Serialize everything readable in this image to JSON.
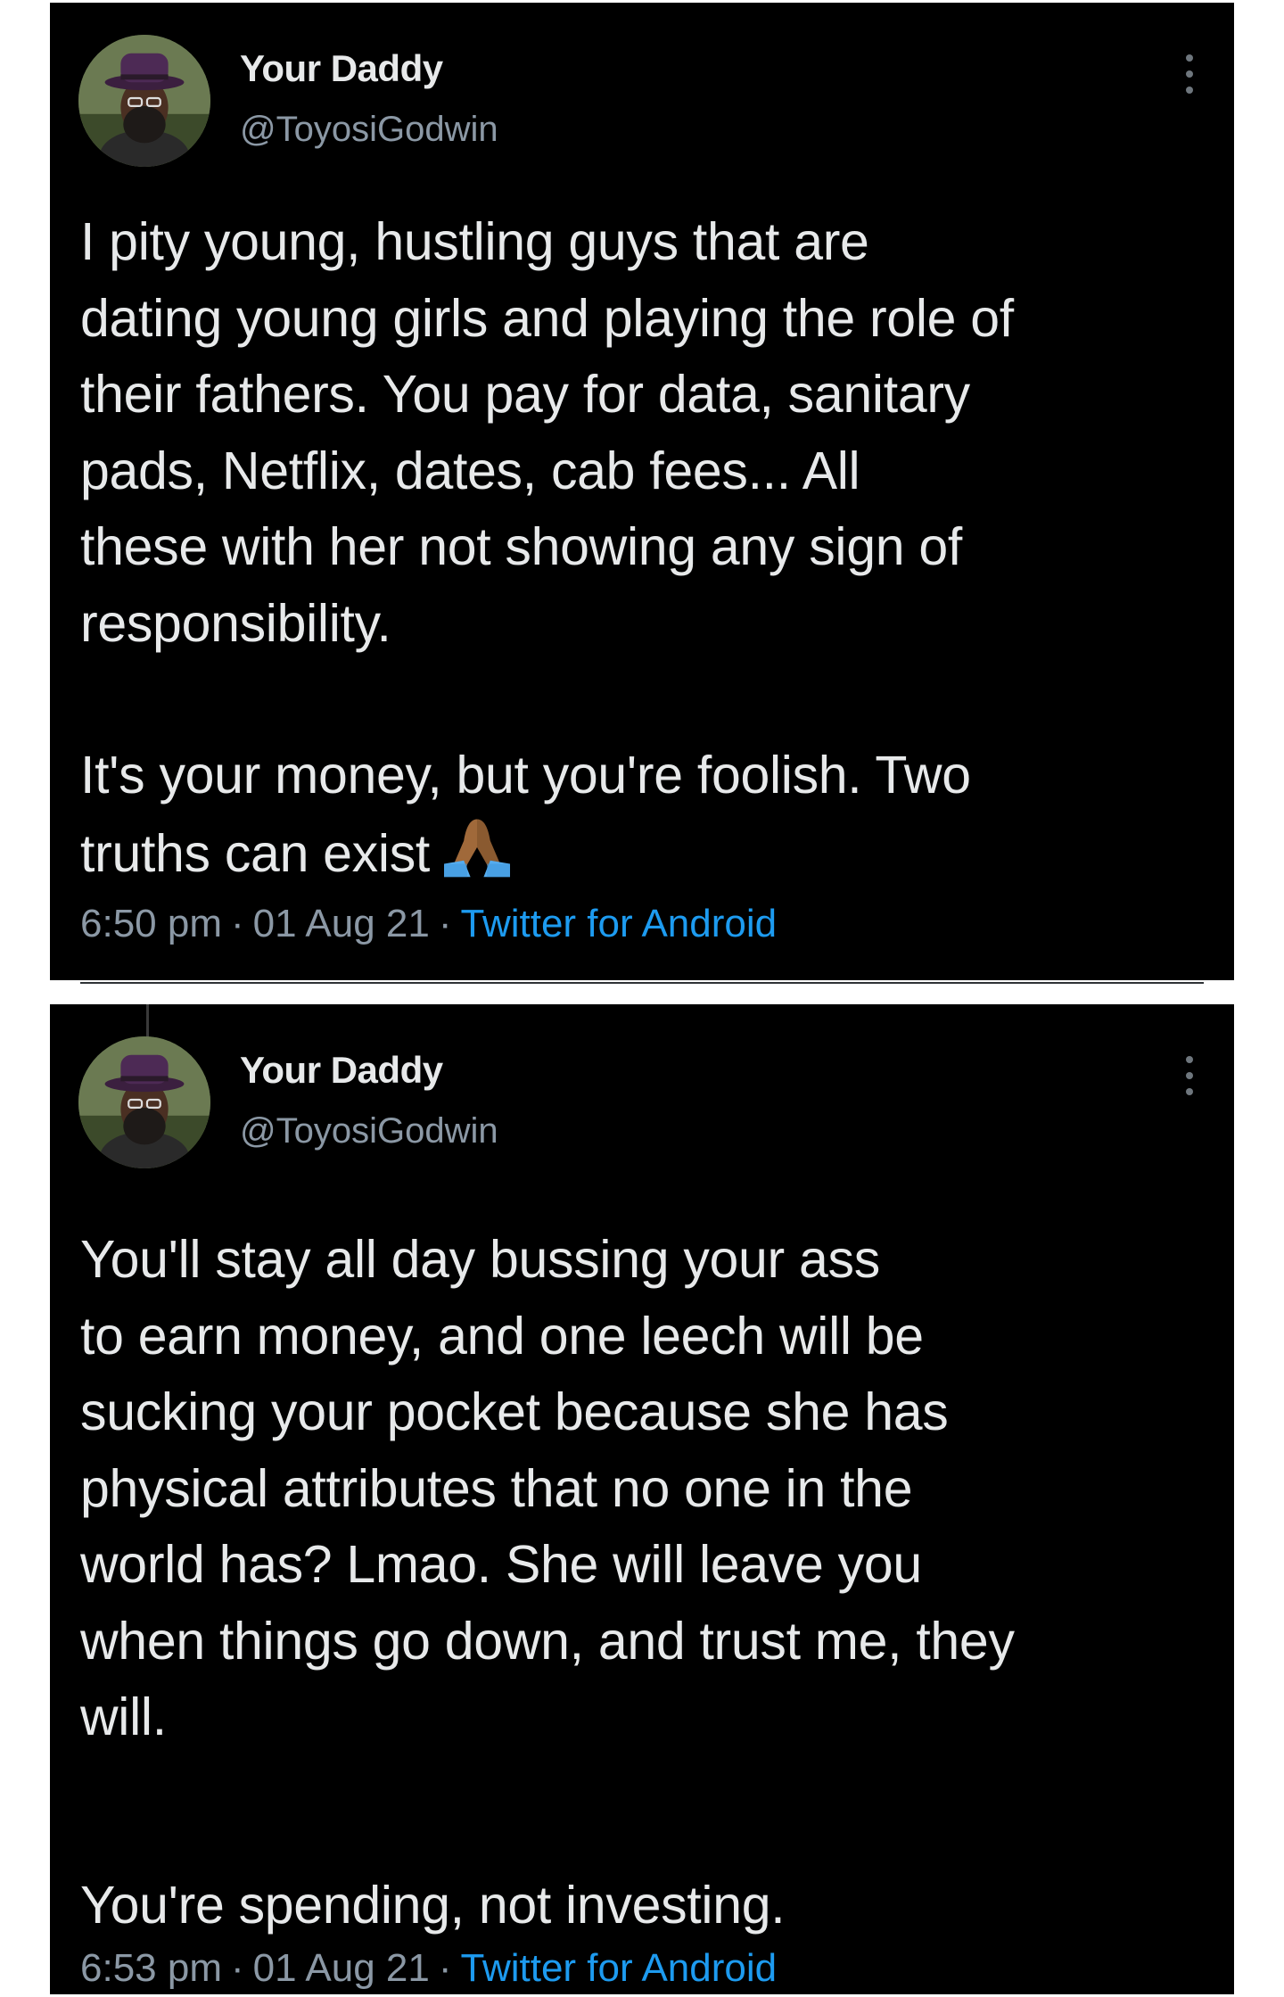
{
  "tweets": [
    {
      "author_name": "Your Daddy",
      "author_handle": "@ToyosiGodwin",
      "text_1": "I pity young, hustling guys that are\ndating young girls and playing the role of\ntheir fathers. You pay for data, sanitary\npads, Netflix, dates, cab fees... All\nthese with her not showing any sign of\nresponsibility.",
      "text_2": "It's your money, but you're foolish. Two\ntruths can exist",
      "emoji": "folded-hands-emoji",
      "time": "6:50 pm",
      "date": "01 Aug 21",
      "source": "Twitter for Android"
    },
    {
      "author_name": "Your Daddy",
      "author_handle": "@ToyosiGodwin",
      "text_1": "You'll stay all day bussing your ass\nto earn money, and one leech will be\nsucking your pocket because she has\nphysical attributes that no one in the\nworld has? Lmao. She will leave you\nwhen things go down, and trust me, they\nwill.",
      "text_2": "You're spending, not investing.",
      "time": "6:53 pm",
      "date": "01 Aug 21",
      "source": "Twitter for Android"
    }
  ],
  "separator": "·",
  "colors": {
    "background": "#000000",
    "text": "#e7e9ea",
    "secondary": "#8b98a5",
    "link": "#1d9bf0"
  }
}
